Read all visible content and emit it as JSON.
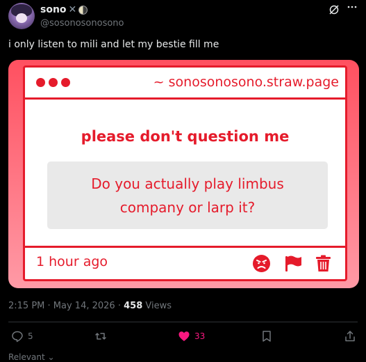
{
  "author": {
    "display_name": "sono",
    "handle": "@sosonosonosono",
    "name_emoji": [
      "x",
      "half-moon"
    ]
  },
  "tweet": {
    "text": "i only listen to mili and let my bestie fill me"
  },
  "card": {
    "url": "~ sonosonosono.straw.page",
    "heading": "please don't question me",
    "question": "Do you actually play limbus company or larp it?",
    "time_ago": "1 hour ago",
    "icons": [
      "angry-face-icon",
      "flag-icon",
      "trash-icon"
    ],
    "colors": {
      "accent": "#e51b2b",
      "gradient_top": "#ff5060",
      "gradient_bottom": "#ff9aa6",
      "box_bg": "#e9e9e9"
    }
  },
  "meta": {
    "time": "2:15 PM",
    "separator": " · ",
    "date": "May 14, 2026",
    "views_count": "458",
    "views_label": " Views"
  },
  "actions": {
    "replies": "5",
    "reposts": "",
    "likes": "33",
    "colors": {
      "like": "#f91880",
      "muted": "#71767b"
    }
  },
  "sort": {
    "label": "Relevant"
  }
}
